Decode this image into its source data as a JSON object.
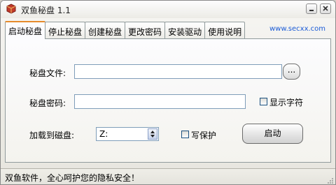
{
  "window": {
    "title": "双鱼秘盘 1.1"
  },
  "tabs": [
    {
      "label": "启动秘盘",
      "active": true
    },
    {
      "label": "停止秘盘",
      "active": false
    },
    {
      "label": "创建秘盘",
      "active": false
    },
    {
      "label": "更改密码",
      "active": false
    },
    {
      "label": "安装驱动",
      "active": false
    },
    {
      "label": "使用说明",
      "active": false
    }
  ],
  "site_link": "www.secxx.com",
  "form": {
    "disk_file_label": "秘盘文件:",
    "disk_file_value": "",
    "browse_label": "...",
    "password_label": "秘盘密码:",
    "password_value": "",
    "show_chars_label": "显示字符",
    "show_chars_checked": false,
    "mount_label": "加载到磁盘:",
    "drive_value": "Z:",
    "write_protect_label": "写保护",
    "write_protect_checked": false,
    "start_button": "启动"
  },
  "status": {
    "text": "双鱼软件，全心呵护您的隐私安全！"
  },
  "icons": {
    "app": "app-icon",
    "minimize": "minimize-icon",
    "close": "close-icon",
    "spin": "spin-arrows-icon",
    "grip": "resize-grip-icon"
  },
  "colors": {
    "active_tab_accent": "#e68b2c",
    "link": "#1a5bd6",
    "field_border": "#7f9db9"
  }
}
